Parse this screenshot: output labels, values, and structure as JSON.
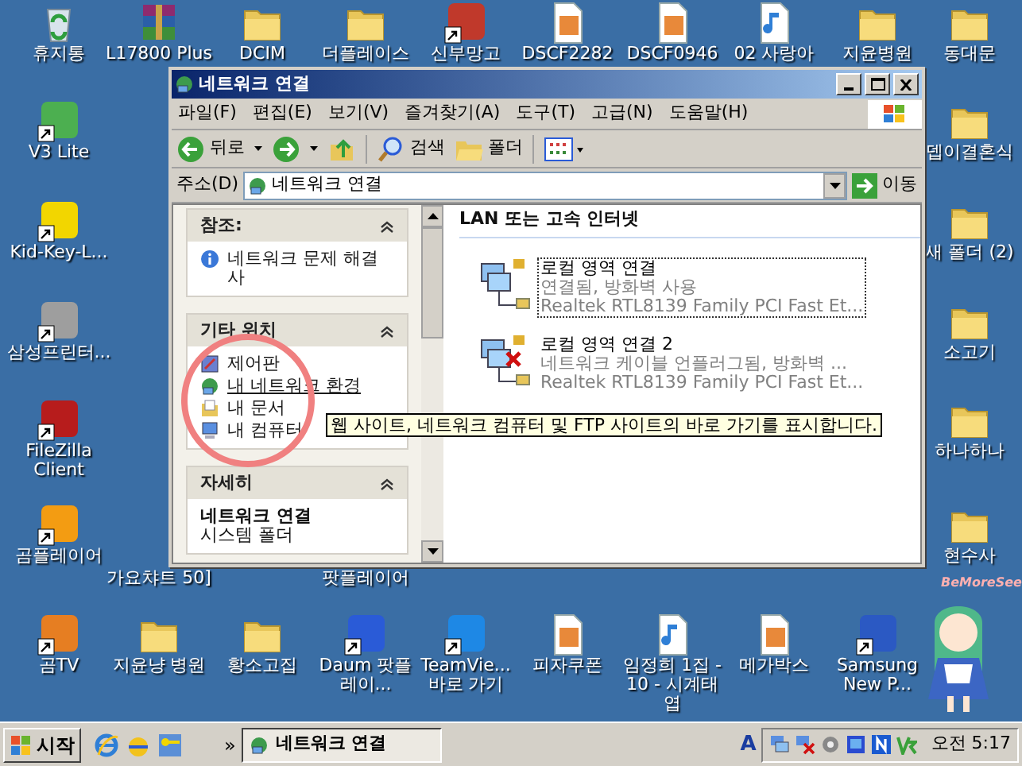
{
  "desktop_icons": [
    {
      "label": "휴지통",
      "kind": "recycle",
      "shortcut": false
    },
    {
      "label": "L17800 Plus",
      "kind": "archive",
      "shortcut": false
    },
    {
      "label": "DCIM",
      "kind": "folder",
      "shortcut": false
    },
    {
      "label": "더플레이스",
      "kind": "folder",
      "shortcut": false
    },
    {
      "label": "신부망고",
      "kind": "app",
      "shortcut": true,
      "color": "#c0392b"
    },
    {
      "label": "DSCF2282",
      "kind": "image",
      "shortcut": false
    },
    {
      "label": "DSCF0946",
      "kind": "image",
      "shortcut": false
    },
    {
      "label": "02 사랑아",
      "kind": "audio",
      "shortcut": false
    },
    {
      "label": "지윤병원",
      "kind": "folder",
      "shortcut": false
    },
    {
      "label": "동대문",
      "kind": "folder",
      "shortcut": false
    },
    {
      "label": "V3 Lite",
      "kind": "app",
      "shortcut": true,
      "color": "#4caf50"
    },
    {
      "label": "뎁이결혼식",
      "kind": "folder",
      "shortcut": false
    },
    {
      "label": "Kid-Key-L...",
      "kind": "app",
      "shortcut": true,
      "color": "#f2d600"
    },
    {
      "label": "새 폴더 (2)",
      "kind": "folder",
      "shortcut": false
    },
    {
      "label": "삼성프린터...",
      "kind": "app",
      "shortcut": true,
      "color": "#9e9e9e"
    },
    {
      "label": "소고기",
      "kind": "folder",
      "shortcut": false
    },
    {
      "label": "FileZilla Client",
      "kind": "app",
      "shortcut": true,
      "color": "#b71c1c"
    },
    {
      "label": "하나하나",
      "kind": "folder",
      "shortcut": false
    },
    {
      "label": "곰플레이어",
      "kind": "app",
      "shortcut": true,
      "color": "#f39c12"
    },
    {
      "label": "가요챠트 50]",
      "kind": "label-only"
    },
    {
      "label": "팟플레이어",
      "kind": "label-only"
    },
    {
      "label": "현수사",
      "kind": "folder",
      "shortcut": false
    },
    {
      "label": "곰TV",
      "kind": "app",
      "shortcut": true,
      "color": "#e67e22"
    },
    {
      "label": "지윤냥 병원",
      "kind": "folder",
      "shortcut": false
    },
    {
      "label": "황소고집",
      "kind": "folder",
      "shortcut": false
    },
    {
      "label": "Daum 팟플레이...",
      "kind": "app",
      "shortcut": true,
      "color": "#2a5bd7"
    },
    {
      "label": "TeamVie... 바로 가기",
      "kind": "app",
      "shortcut": true,
      "color": "#1e88e5"
    },
    {
      "label": "피자쿠폰",
      "kind": "image",
      "shortcut": false
    },
    {
      "label": "임정희 1집 - 10 - 시계태엽",
      "kind": "audio",
      "shortcut": false
    },
    {
      "label": "메가박스",
      "kind": "image",
      "shortcut": false
    },
    {
      "label": "Samsung New P...",
      "kind": "app",
      "shortcut": true,
      "color": "#2b59c3"
    }
  ],
  "window": {
    "title": "네트워크 연결",
    "menu": [
      "파일(F)",
      "편집(E)",
      "보기(V)",
      "즐겨찾기(A)",
      "도구(T)",
      "고급(N)",
      "도움말(H)"
    ],
    "toolbar": {
      "back": "뒤로",
      "search": "검색",
      "folders": "폴더"
    },
    "address": {
      "label": "주소(D)",
      "value": "네트워크 연결",
      "go": "이동"
    },
    "sidebar": [
      {
        "title": "참조:",
        "expanded": true,
        "items": [
          {
            "label": "네트워크 문제 해결사",
            "kind": "info",
            "hovered": false
          }
        ]
      },
      {
        "title": "기타 위치",
        "expanded": true,
        "items": [
          {
            "label": "제어판",
            "kind": "control-panel",
            "hovered": false
          },
          {
            "label": "내 네트워크 환경",
            "kind": "network",
            "hovered": true
          },
          {
            "label": "내 문서",
            "kind": "documents",
            "hovered": false
          },
          {
            "label": "내 컴퓨터",
            "kind": "computer",
            "hovered": false
          }
        ]
      },
      {
        "title": "자세히",
        "expanded": true,
        "details": {
          "name": "네트워크 연결",
          "type": "시스템 폴더"
        }
      }
    ],
    "group": "LAN 또는 고속 인터넷",
    "connections": [
      {
        "name": "로컬 영역 연결",
        "status": "연결됨, 방화벽 사용",
        "adapter": "Realtek RTL8139 Family PCI Fast Et...",
        "connected": true,
        "selected": true
      },
      {
        "name": "로컬 영역 연결 2",
        "status": "네트워크 케이블 언플러그됨, 방화벽 ...",
        "adapter": "Realtek RTL8139 Family PCI Fast Et...",
        "connected": false,
        "selected": false
      }
    ],
    "tooltip": "웹 사이트, 네트워크 컴퓨터 및 FTP 사이트의 바로 가기를 표시합니다."
  },
  "mascot_text": "BeMoreSee",
  "taskbar": {
    "start": "시작",
    "overflow": "»",
    "tasks": [
      {
        "label": "네트워크 연결",
        "selected": true
      }
    ],
    "tray_text": "A",
    "clock": "오전 5:17"
  }
}
